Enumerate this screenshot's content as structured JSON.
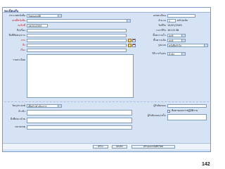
{
  "window": {
    "title": "ทะเบียนรับ"
  },
  "left": {
    "doc_type_label": "ประเภทหนังสือ",
    "doc_type_value": "รับคุณสมบัติ",
    "doc_no_label": "เลขที่หนังสือ",
    "doc_date_label": "ลงวันที่",
    "doc_date_value": "14/01/2549",
    "to_label": "ถึง/เรื่อง",
    "from_label": "ชื่อที่ติดต่อ/จาก",
    "from_org_label": "จาก",
    "to_org_label": "ถึง",
    "subject_label": "เรื่อง",
    "note_label": "รายละเอียด"
  },
  "right": {
    "reg_no_label": "เลขทะเบียน",
    "copies_label": "จำนวน",
    "copies_value": "1",
    "copies_unit": "หน้า/ฉบับ",
    "recv_date_label": "วันที่รับ",
    "recv_date_value": "14/01/2549",
    "recv_time_label": "เวลาที่รับ",
    "recv_time_value": "16:13:38",
    "urgency_label": "ชั้นความเร็ว",
    "urgency_value": "ปกติ",
    "secrecy_label": "ชั้นความลับ",
    "secrecy_value": "ปกติ",
    "channel_label": "รูปแบบ",
    "channel_value": "หนังสือทั่วไป",
    "action_label": "วิธีการรับ/ส่ง",
    "action_value": "นำส่ง"
  },
  "lower": {
    "objective_label": "วัตถุประสงค์",
    "objective_value": "เพื่อทำ/ดำเนินการ",
    "ref_label": "อ้างอิง",
    "attach_label": "สิ่งที่ส่งมาด้วย",
    "remark_label": "หมายเหตุ",
    "owner_label": "ผู้รับผิดชอบ",
    "check_label": "ติดตามผลการปฏิบัติงาน",
    "handler_label": "ผู้รับผิดชอบ/เสร็จ"
  },
  "buttons": {
    "create": "สร้าง",
    "cancel": "ยกเลิก",
    "create_new": "สร้างและบันทึกใหม่"
  },
  "page_number": "142"
}
